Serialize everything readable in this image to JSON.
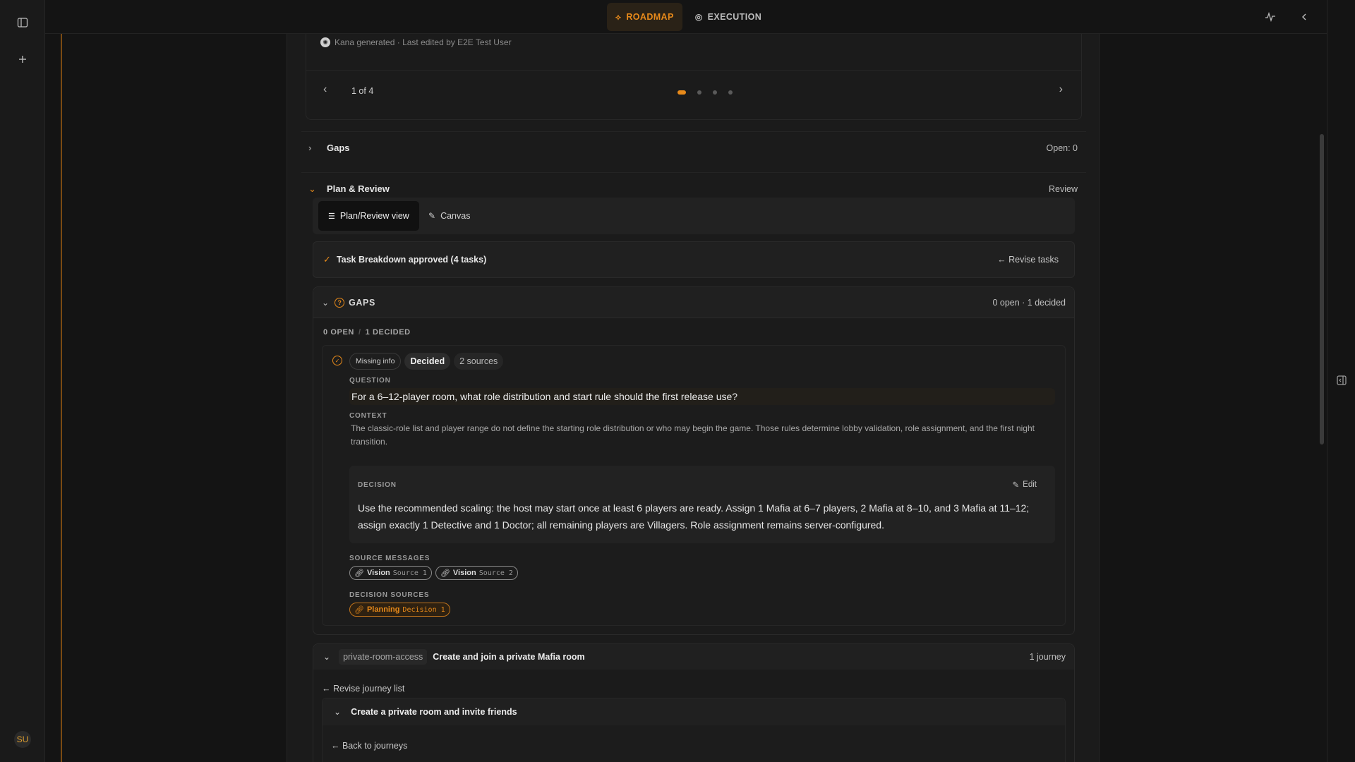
{
  "top_tabs": {
    "roadmap": "ROADMAP",
    "execution": "EXECUTION"
  },
  "sidebar": {
    "user_initials": "SU"
  },
  "pager": {
    "credit": "Kana generated · Last edited by E2E Test User",
    "label": "1 of 4",
    "pages": 4,
    "current": 1
  },
  "sections": {
    "gaps": {
      "title": "Gaps",
      "right": "Open: 0"
    },
    "plan_review": {
      "title": "Plan & Review",
      "right": "Review"
    }
  },
  "view_toggle": {
    "plan_review": "Plan/Review view",
    "canvas": "Canvas"
  },
  "approved": {
    "title": "Task Breakdown approved (4 tasks)",
    "revise": "← Revise tasks"
  },
  "gaps_panel": {
    "label": "GAPS",
    "count": "0 open · 1 decided",
    "open_label": "0 OPEN",
    "separator": "/",
    "decided_label": "1 DECIDED",
    "item": {
      "chip_missing": "Missing info",
      "chip_decided": "Decided",
      "chip_sources": "2 sources",
      "question_label": "QUESTION",
      "question": "For a 6–12-player room, what role distribution and start rule should the first release use?",
      "context_label": "CONTEXT",
      "context": "The classic-role list and player range do not define the starting role distribution or who may begin the game. Those rules determine lobby validation, role assignment, and the first night transition.",
      "decision_label": "DECISION",
      "edit_label": "Edit",
      "decision": "Use the recommended scaling: the host may start once at least 6 players are ready. Assign 1 Mafia at 6–7 players, 2 Mafia at 8–10, and 3 Mafia at 11–12; assign exactly 1 Detective and 1 Doctor; all remaining players are Villagers. Role assignment remains server-configured.",
      "source_messages_label": "SOURCE MESSAGES",
      "source_messages": [
        {
          "kind": "Vision",
          "ref": "Source 1"
        },
        {
          "kind": "Vision",
          "ref": "Source 2"
        }
      ],
      "decision_sources_label": "DECISION SOURCES",
      "decision_sources": [
        {
          "kind": "Planning",
          "ref": "Decision 1"
        }
      ]
    }
  },
  "journey": {
    "slug": "private-room-access",
    "title": "Create and join a private Mafia room",
    "count": "1 journey",
    "revise": "← Revise journey list",
    "sub_title": "Create a private room and invite friends",
    "back": "← Back to journeys"
  },
  "colors": {
    "accent": "#e88a1a",
    "background": "#141414",
    "panel": "#1b1b1b"
  }
}
